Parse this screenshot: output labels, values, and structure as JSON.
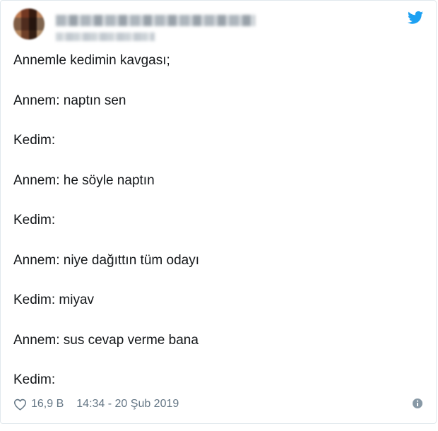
{
  "tweet": {
    "lines": [
      "Annemle kedimin kavgası;",
      "Annem: naptın sen",
      "Kedim:",
      "Annem: he söyle naptın",
      "Kedim:",
      "Annem: niye dağıttın tüm odayı",
      "Kedim: miyav",
      "Annem: sus cevap verme bana",
      "Kedim:"
    ],
    "like_count": "16,9 B",
    "timestamp": "14:34 - 20 Şub 2019"
  },
  "icons": {
    "brand": "twitter-bird-icon",
    "like": "heart-icon",
    "info": "info-icon"
  },
  "colors": {
    "twitter_blue": "#1da1f2",
    "meta_gray": "#657786",
    "text": "#14171a"
  }
}
